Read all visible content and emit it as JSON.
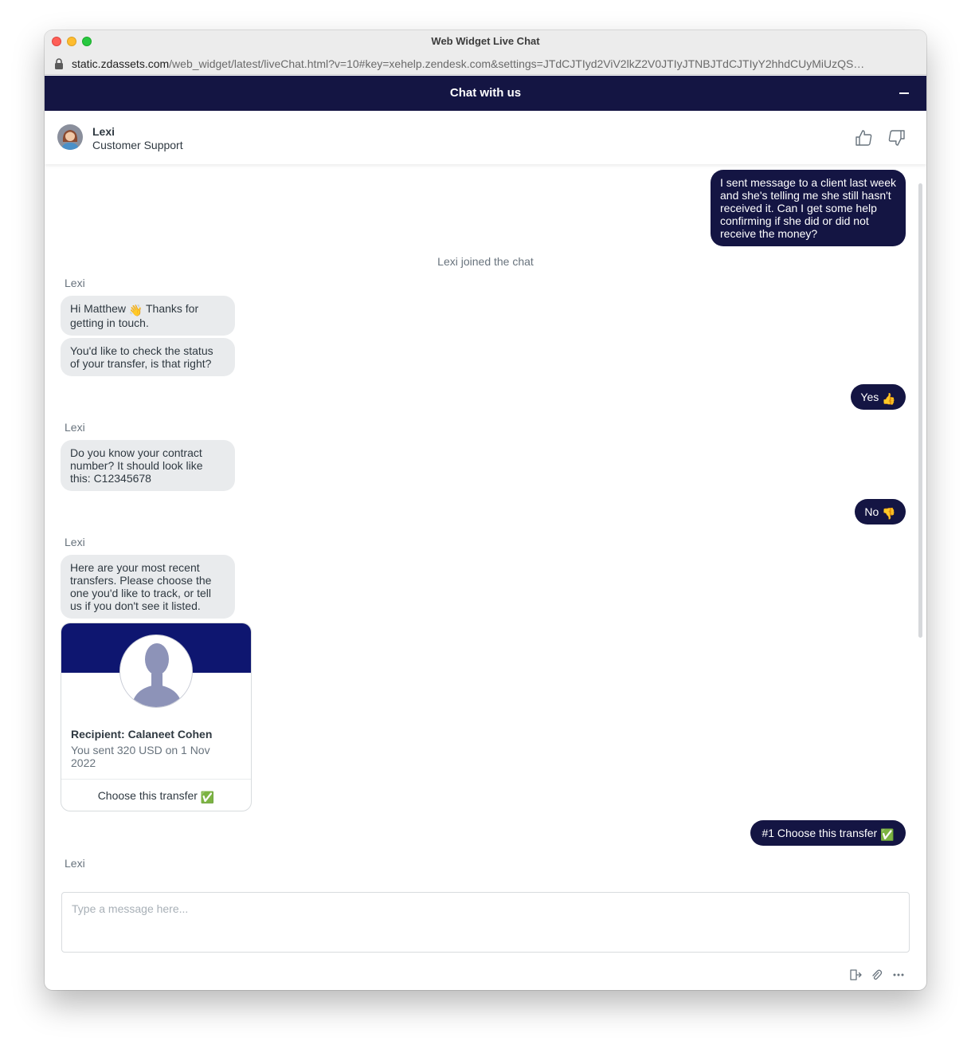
{
  "browser": {
    "window_title": "Web Widget Live Chat",
    "url_host": "static.zdassets.com",
    "url_path": "/web_widget/latest/liveChat.html?v=10#key=xehelp.zendesk.com&settings=JTdCJTIyd2ViV2lkZ2V0JTIyJTNBJTdCJTIyY2hhdCUyMiUzQS…"
  },
  "header": {
    "title": "Chat with us"
  },
  "agent": {
    "name": "Lexi",
    "role": "Customer Support"
  },
  "messages": {
    "user_1": "I sent message to a client last week and she's telling me she still hasn't received it. Can I get some help confirming if she did or did not receive the money?",
    "system_joined": "Lexi joined the chat",
    "sender_1": "Lexi",
    "bot_1_text": "Hi Matthew",
    "bot_1_emoji": "👋",
    "bot_1_text_after": " Thanks for getting in touch.",
    "bot_2": "You'd like to check the status of your transfer, is that right?",
    "user_2_text": "Yes ",
    "user_2_emoji": "👍",
    "sender_2": "Lexi",
    "bot_3": "Do you know your contract number? It should look like this: C12345678",
    "user_3_text": "No ",
    "user_3_emoji": "👎",
    "sender_3": "Lexi",
    "bot_4": "Here are your most recent transfers. Please choose the one you'd like to track, or tell us if you don't see it listed.",
    "user_4_text": "#1 Choose this transfer ",
    "user_4_emoji": "✅",
    "sender_4": "Lexi"
  },
  "card": {
    "title": "Recipient: Calaneet Cohen",
    "subtitle": "You sent 320 USD on 1 Nov 2022",
    "action_text": "Choose this transfer ",
    "action_emoji": "✅"
  },
  "composer": {
    "placeholder": "Type a message here..."
  },
  "icons": {
    "thumbs_up": "thumbs-up-icon",
    "thumbs_down": "thumbs-down-icon",
    "end_chat": "end-chat-icon",
    "attachment": "paperclip-icon",
    "more": "more-options-icon"
  },
  "colors": {
    "brand": "#141543",
    "card_banner": "#0e1670",
    "bot_bubble": "#e9ebed"
  }
}
